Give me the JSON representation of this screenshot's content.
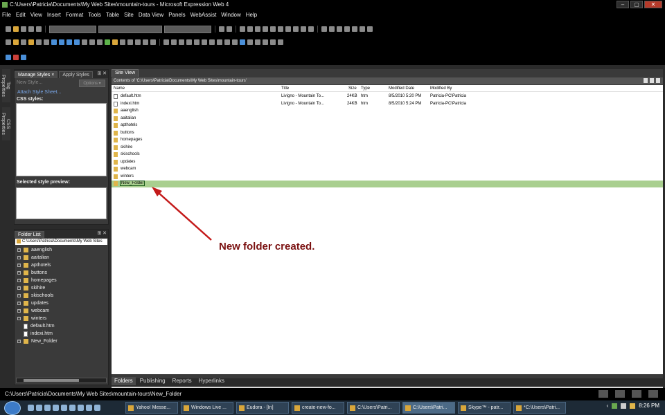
{
  "window": {
    "title": "C:\\Users\\Patricia\\Documents\\My Web Sites\\mountain-tours - Microsoft Expression Web 4",
    "controls": [
      "–",
      "▢",
      "✕"
    ]
  },
  "menu": [
    "File",
    "Edit",
    "View",
    "Insert",
    "Format",
    "Tools",
    "Table",
    "Site",
    "Data View",
    "Panels",
    "WebAssist",
    "Window",
    "Help"
  ],
  "left_rail": {
    "tabs": [
      "Tag Properties",
      "CSS Properties"
    ]
  },
  "styles_panel": {
    "tabs": [
      "Manage Styles",
      "Apply Styles"
    ],
    "tab_close": "×",
    "controls": "⊞ ✕",
    "new_style": "New Style...",
    "options_label": "Options ▾",
    "attach_label": "Attach Style Sheet...",
    "css_styles_label": "CSS styles:",
    "preview_label": "Selected style preview:"
  },
  "folder_panel": {
    "title": "Folder List",
    "controls": "⊞ ✕",
    "root_path": "C:\\Users\\Patricia\\Documents\\My Web Sites",
    "items": [
      {
        "name": "aaenglish",
        "type": "folder"
      },
      {
        "name": "aaitalian",
        "type": "folder"
      },
      {
        "name": "apthotels",
        "type": "folder"
      },
      {
        "name": "buttons",
        "type": "folder"
      },
      {
        "name": "homepages",
        "type": "folder"
      },
      {
        "name": "skihire",
        "type": "folder"
      },
      {
        "name": "skischools",
        "type": "folder"
      },
      {
        "name": "updates",
        "type": "folder"
      },
      {
        "name": "webcam",
        "type": "folder"
      },
      {
        "name": "winters",
        "type": "folder"
      },
      {
        "name": "default.htm",
        "type": "file"
      },
      {
        "name": "indexi.htm",
        "type": "file"
      },
      {
        "name": "New_Folder",
        "type": "folder"
      }
    ]
  },
  "site_view": {
    "tab": "Site View",
    "contents_label": "Contents of 'C:\\Users\\Patricia\\Documents\\My Web Sites\\mountain-tours'",
    "columns": [
      "Name",
      "Title",
      "Size",
      "Type",
      "Modified Date",
      "Modified By"
    ],
    "rows": [
      {
        "name": "default.htm",
        "title": "Livigno - Mountain To...",
        "size": "24KB",
        "type": "htm",
        "date": "8/5/2010 5:20 PM",
        "by": "Patricia-PC\\Patricia",
        "kind": "html"
      },
      {
        "name": "indexi.htm",
        "title": "Livigno - Mountain To...",
        "size": "24KB",
        "type": "htm",
        "date": "8/5/2010 5:24 PM",
        "by": "Patricia-PC\\Patricia",
        "kind": "html"
      },
      {
        "name": "aaenglish",
        "title": "",
        "size": "",
        "type": "",
        "date": "",
        "by": "",
        "kind": "folder"
      },
      {
        "name": "aaitalian",
        "title": "",
        "size": "",
        "type": "",
        "date": "",
        "by": "",
        "kind": "folder"
      },
      {
        "name": "apthotels",
        "title": "",
        "size": "",
        "type": "",
        "date": "",
        "by": "",
        "kind": "folder"
      },
      {
        "name": "buttons",
        "title": "",
        "size": "",
        "type": "",
        "date": "",
        "by": "",
        "kind": "folder"
      },
      {
        "name": "homepages",
        "title": "",
        "size": "",
        "type": "",
        "date": "",
        "by": "",
        "kind": "folder"
      },
      {
        "name": "skihire",
        "title": "",
        "size": "",
        "type": "",
        "date": "",
        "by": "",
        "kind": "folder"
      },
      {
        "name": "skischools",
        "title": "",
        "size": "",
        "type": "",
        "date": "",
        "by": "",
        "kind": "folder"
      },
      {
        "name": "updates",
        "title": "",
        "size": "",
        "type": "",
        "date": "",
        "by": "",
        "kind": "folder"
      },
      {
        "name": "webcam",
        "title": "",
        "size": "",
        "type": "",
        "date": "",
        "by": "",
        "kind": "folder"
      },
      {
        "name": "winters",
        "title": "",
        "size": "",
        "type": "",
        "date": "",
        "by": "",
        "kind": "folder"
      },
      {
        "name": "New_Folder",
        "title": "",
        "size": "",
        "type": "",
        "date": "",
        "by": "",
        "kind": "folder",
        "selected": true
      }
    ],
    "bottom_tabs": [
      "Folders",
      "Publishing",
      "Reports",
      "Hyperlinks"
    ]
  },
  "annotation": {
    "text": "New folder created.",
    "color": "#7a1010"
  },
  "status_bar": {
    "path": "C:\\Users\\Patricia\\Documents\\My Web Sites\\mountain-tours\\New_Folder"
  },
  "taskbar": {
    "buttons": [
      "Yahoo! Messe...",
      "Windows Live ...",
      "Eudora - [In]",
      "create-new-fo...",
      "C:\\Users\\Patri...",
      "C:\\Users\\Patri...",
      "Skype™ - patr...",
      "*C:\\Users\\Patri..."
    ],
    "active_index": 5,
    "clock": "8:26 PM"
  }
}
